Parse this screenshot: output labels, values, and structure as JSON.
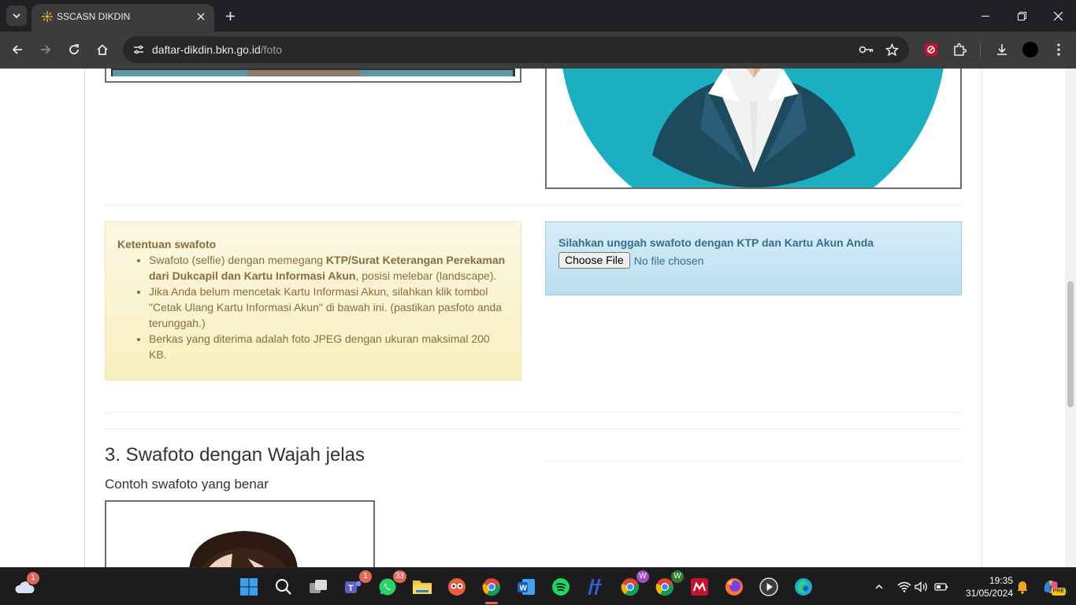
{
  "browser": {
    "tab_title": "SSCASN DIKDIN",
    "url_host": "daftar-dikdin.bkn.go.id",
    "url_path": "/foto"
  },
  "page": {
    "swafoto_rules": {
      "heading": "Ketentuan swafoto",
      "item1_a": "Swafoto (selfie) dengan memegang ",
      "item1_b": "KTP/Surat Keterangan Perekaman dari Dukcapil dan Kartu Informasi Akun",
      "item1_c": ", posisi melebar (landscape).",
      "item2": "Jika Anda belum mencetak Kartu Informasi Akun, silahkan klik tombol \"Cetak Ulang Kartu Informasi Akun\" di bawah ini. (pastikan pasfoto anda terunggah.)",
      "item3": "Berkas yang diterima adalah foto JPEG dengan ukuran maksimal 200 KB."
    },
    "upload": {
      "heading": "Silahkan unggah swafoto dengan KTP dan Kartu Akun Anda",
      "button": "Choose File",
      "status": "No file chosen"
    },
    "section3": {
      "title": "3. Swafoto dengan Wajah jelas",
      "subtitle": "Contoh swafoto yang benar"
    }
  },
  "taskbar": {
    "weather_badge": "1",
    "teams_badge": "1",
    "whatsapp_badge": "33",
    "chrome_profile_w1": "W",
    "chrome_profile_w2": "W",
    "copilot_badge": "PRE",
    "time": "19:35",
    "date": "31/05/2024"
  },
  "colors": {
    "warning_text": "#8a6d3b",
    "info_text": "#31708f",
    "avatar_teal": "#1bafc2",
    "suit_dark": "#1d4a5c"
  }
}
